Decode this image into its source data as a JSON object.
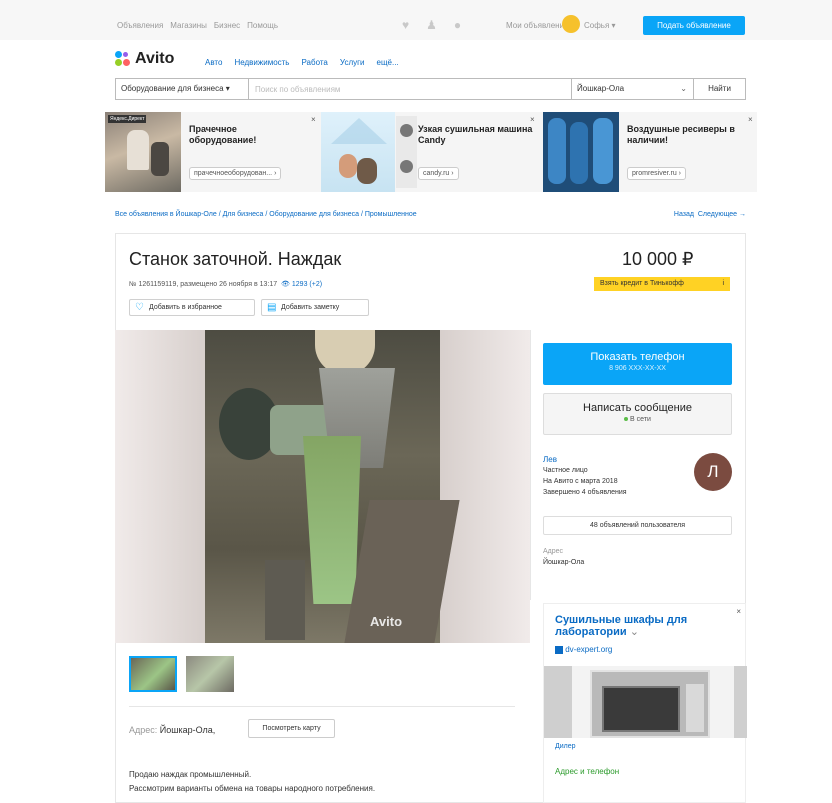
{
  "topbar": {
    "nav": [
      "Объявления",
      "Магазины",
      "Бизнес",
      "Помощь"
    ],
    "icons": [
      "heart-icon",
      "bell-icon",
      "chat-icon"
    ],
    "my_ads": "Мои объявления",
    "user": "Софья",
    "post_button": "Подать объявление",
    "accent": "#0aa5f7"
  },
  "header": {
    "logo": "Avito",
    "categories": [
      "Авто",
      "Недвижимость",
      "Работа",
      "Услуги",
      "ещё..."
    ]
  },
  "search": {
    "category": "Оборудование для бизнеса",
    "placeholder": "Поиск по объявлениям",
    "city": "Йошкар-Ола",
    "button": "Найти"
  },
  "ads": [
    {
      "badge": "Яндекс.Директ",
      "title": "Прачечное оборудование!",
      "url": "прачечноеоборудован..."
    },
    {
      "title": "Узкая сушильная машина Candy",
      "url": "candy.ru"
    },
    {
      "title": "Воздушные ресиверы в наличии!",
      "url": "promresiver.ru"
    }
  ],
  "breadcrumbs": "Все объявления в Йошкар-Оле / Для бизнеса / Оборудование для бизнеса / Промышленное",
  "pager": {
    "back": "Назад",
    "next": "Следующее →"
  },
  "listing": {
    "title": "Станок заточной. Наждак",
    "price": "10 000 ₽",
    "meta": "№ 1261159119, размещено 26 ноября в 13:17",
    "views": "1293 (+2)",
    "credit": "Взять кредит в Тинькофф",
    "fav_button": "Добавить в избранное",
    "note_button": "Добавить заметку",
    "photo_watermark": "Avito",
    "address_label": "Адрес:",
    "address": "Йошкар-Ола,",
    "map_button": "Посмотреть карту",
    "description": [
      "Продаю наждак промышленный.",
      "Рассмотрим варианты обмена на товары народного потребления."
    ]
  },
  "sidebar": {
    "phone_button": "Показать телефон",
    "phone": "8 906 XXX-XX-XX",
    "message_button": "Написать сообщение",
    "online": "В сети",
    "seller_name": "Лев",
    "seller_type": "Частное лицо",
    "seller_since": "На Авито с марта 2018",
    "seller_done": "Завершено 4 объявления",
    "avatar_letter": "Л",
    "user_ads_button": "48 объявлений пользователя",
    "address_label": "Адрес",
    "address": "Йошкар-Ола"
  },
  "side_ad": {
    "title": "Сушильные шкафы для лаборатории",
    "url": "dv-expert.org",
    "dealer": "Дилер",
    "contacts": "Адрес и телефон"
  }
}
